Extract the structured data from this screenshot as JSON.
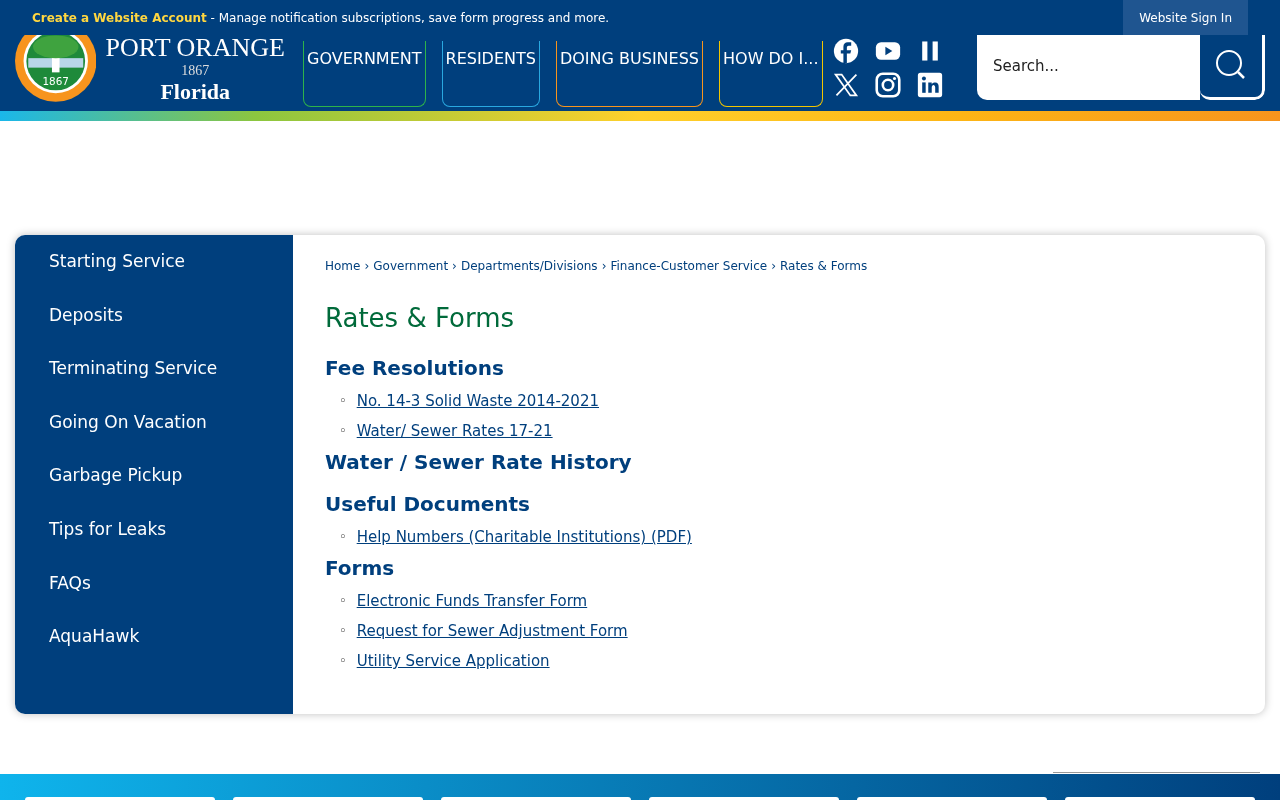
{
  "top_bar": {
    "account_link": "Create a Website Account",
    "message": " - Manage notification subscriptions, save form progress and more.",
    "sign_in": "Website Sign In"
  },
  "logo": {
    "seal_year": "1867",
    "name": "PORT ORANGE",
    "year": "1867",
    "state": "Florida"
  },
  "nav": [
    {
      "label": "GOVERNMENT",
      "color": "#2db34a"
    },
    {
      "label": "RESIDENTS",
      "color": "#29a8e0"
    },
    {
      "label": "DOING BUSINESS",
      "color": "#f7941d"
    },
    {
      "label": "HOW DO I...",
      "color": "#f2c500"
    }
  ],
  "social": [
    {
      "kind": "facebook"
    },
    {
      "kind": "youtube"
    },
    {
      "kind": "bars"
    },
    {
      "kind": "x"
    },
    {
      "kind": "instagram"
    },
    {
      "kind": "linkedin"
    }
  ],
  "search": {
    "placeholder": "Search..."
  },
  "sidebar": {
    "items": [
      "Starting Service",
      "Deposits",
      "Terminating Service",
      "Going On Vacation",
      "Garbage Pickup",
      "Tips for Leaks",
      "FAQs",
      "AquaHawk"
    ]
  },
  "breadcrumbs": [
    {
      "label": "Home"
    },
    {
      "separator": "›",
      "label": "Government"
    },
    {
      "separator": "›",
      "label": "Departments/Divisions"
    },
    {
      "separator": "›",
      "label": "Finance-Customer Service"
    },
    {
      "separator": "›",
      "label": "Rates & Forms"
    }
  ],
  "page_title": "Rates & Forms",
  "sections": [
    {
      "heading": "Fee Resolutions",
      "links": [
        {
          "marker": "◦",
          "text": "No. 14-3 Solid Waste 2014-2021"
        },
        {
          "marker": "◦",
          "text": "Water/ Sewer Rates 17-21"
        }
      ]
    },
    {
      "heading": "Water / Sewer Rate History"
    },
    {
      "heading": "Useful Documents",
      "links": [
        {
          "marker": "◦",
          "text": "Help Numbers (Charitable Institutions) (PDF)"
        }
      ]
    },
    {
      "heading": "Forms",
      "links": [
        {
          "marker": "◦",
          "text": "Electronic Funds Transfer Form"
        },
        {
          "marker": "◦",
          "text": "Request for Sewer Adjustment Form"
        },
        {
          "marker": "◦",
          "text": "Utility Service Application"
        }
      ]
    }
  ]
}
